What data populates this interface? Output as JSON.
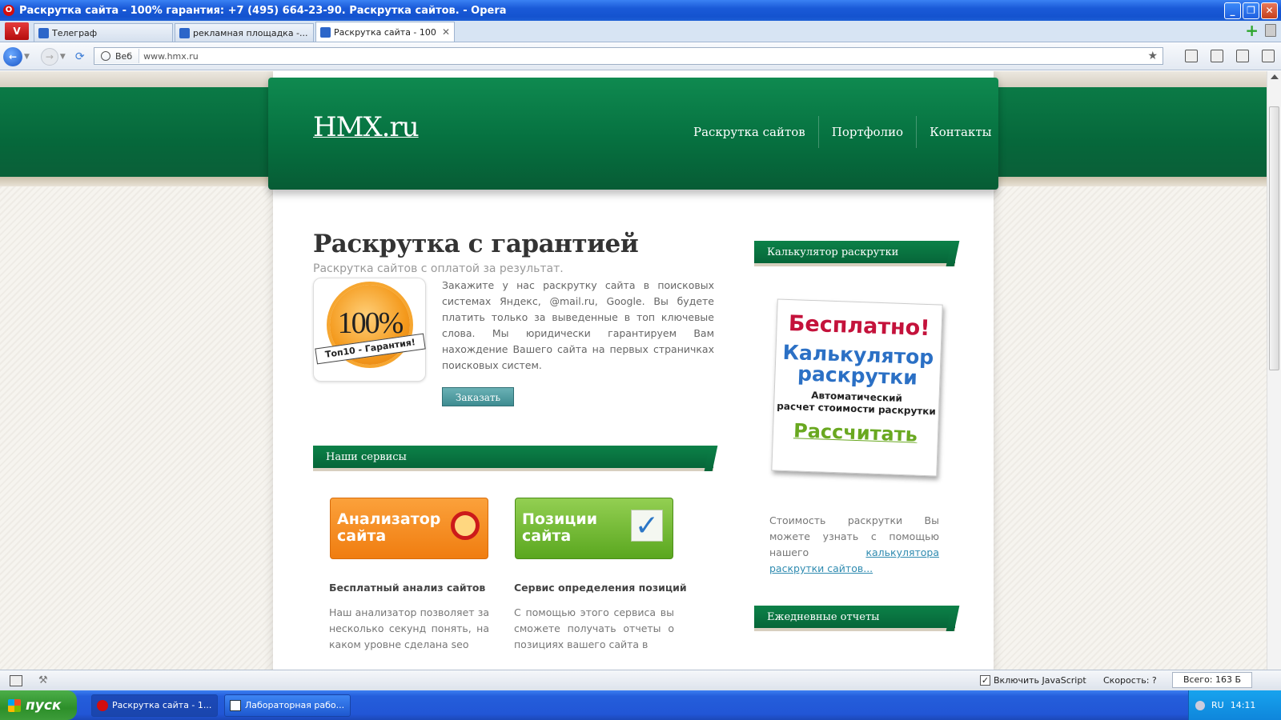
{
  "window": {
    "title": "Раскрутка сайта - 100% гарантия: +7 (495) 664-23-90. Раскрутка сайтов. - Opera",
    "opera_menu_label": "V",
    "buttons": {
      "minimize": "_",
      "maximize": "❐",
      "close": "✕"
    }
  },
  "tabs": [
    {
      "label": "Телеграф",
      "active": false
    },
    {
      "label": "рекламная площадка -...",
      "active": false
    },
    {
      "label": "Раскрутка сайта - 100...",
      "active": true
    }
  ],
  "address_bar": {
    "badge": "Веб",
    "url": "www.hmx.ru"
  },
  "site": {
    "logo": "HMX.ru",
    "nav": [
      "Раскрутка сайтов",
      "Портфолио",
      "Контакты"
    ],
    "hero": {
      "title": "Раскрутка с гарантией",
      "subtitle": "Раскрутка сайтов с оплатой за результат.",
      "badge_percent": "100%",
      "badge_ribbon": "Топ10 - Гарантия!",
      "text": "Закажите у нас раскрутку сайта в поисковых системах Яндекс, @mail.ru, Google. Вы будете платить только за выведенные в топ ключевые слова. Мы юридически гарантируем Вам нахождение Вашего сайта на первых страничках поисковых систем.",
      "order_button": "Заказать"
    },
    "services": {
      "heading": "Наши сервисы",
      "items": [
        {
          "card_line1": "Анализатор",
          "card_line2": "сайта",
          "title": "Бесплатный анализ сайтов",
          "text": "Наш анализатор позволяет за несколько секунд понять, на каком уровне сделана seo"
        },
        {
          "card_line1": "Позиции",
          "card_line2": "сайта",
          "title": "Сервис определения позиций",
          "text": "С помощью этого сервиса вы сможете получать отчеты о позициях вашего сайта в"
        }
      ]
    },
    "sidebar": {
      "calc_heading": "Калькулятор раскрутки",
      "promo": {
        "free": "Бесплатно!",
        "title_line1": "Калькулятор",
        "title_line2": "раскрутки",
        "sub_line1": "Автоматический",
        "sub_line2": "расчет стоимости раскрутки",
        "cta": "Рассчитать"
      },
      "calc_text_before": "Стоимость раскрутки Вы можете узнать с помощью нашего ",
      "calc_link": "калькулятора раскрутки сайтов...",
      "reports_heading": "Ежедневные отчеты"
    }
  },
  "status_bar": {
    "js_label": "Включить JavaScript",
    "js_checked": "✓",
    "speed": "Скорость:  ?",
    "total": "Всего:   163 Б"
  },
  "taskbar": {
    "start_label": "пуск",
    "items": [
      {
        "label": "Раскрутка сайта - 1..."
      },
      {
        "label": "Лабораторная рабо..."
      }
    ],
    "tray": {
      "lang": "RU",
      "time": "14:11"
    }
  },
  "colors": {
    "brand_green": "#06683b",
    "accent_teal": "#3e8c91",
    "link": "#2f8bb0",
    "xp_blue": "#245edb"
  }
}
